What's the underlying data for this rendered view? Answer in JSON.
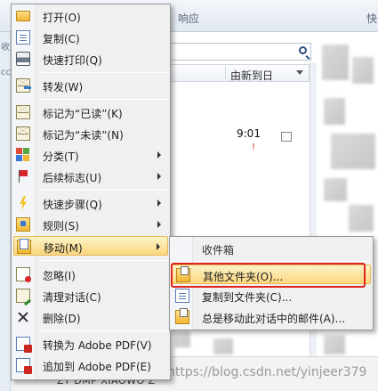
{
  "background": {
    "ribbon_labels": [
      "响应",
      "快"
    ],
    "left_labels": [
      "收",
      "cc"
    ],
    "column_header": "由新到日",
    "message_time": "9:01",
    "bottom_text": "ZT DMP XIAOWO Z",
    "watermark": "https://blog.csdn.net/yinjeer379"
  },
  "menu": {
    "items": [
      {
        "label": "打开(O)",
        "icon": "open-folder-icon"
      },
      {
        "label": "复制(C)",
        "icon": "copy-icon"
      },
      {
        "label": "快速打印(Q)",
        "icon": "printer-icon"
      },
      {
        "label": "转发(W)",
        "icon": "forward-icon"
      },
      {
        "label": "标记为“已读”(K)",
        "icon": "mark-read-icon"
      },
      {
        "label": "标记为“未读”(N)",
        "icon": "mark-unread-icon"
      },
      {
        "label": "分类(T)",
        "icon": "categorize-icon"
      },
      {
        "label": "后续标志(U)",
        "icon": "flag-icon"
      },
      {
        "label": "快速步骤(Q)",
        "icon": "lightning-icon"
      },
      {
        "label": "规则(S)",
        "icon": "rules-icon"
      },
      {
        "label": "移动(M)",
        "icon": "move-icon"
      },
      {
        "label": "忽略(I)",
        "icon": "ignore-icon"
      },
      {
        "label": "清理对话(C)",
        "icon": "clean-up-icon"
      },
      {
        "label": "删除(D)",
        "icon": "delete-icon"
      },
      {
        "label": "转换为 Adobe PDF(V)",
        "icon": "pdf-convert-icon"
      },
      {
        "label": "追加到 Adobe PDF(E)",
        "icon": "pdf-append-icon"
      }
    ]
  },
  "submenu": {
    "header": "收件箱",
    "items": [
      {
        "label": "其他文件夹(O)...",
        "icon": "folder-icon"
      },
      {
        "label": "复制到文件夹(C)...",
        "icon": "copy-to-folder-icon"
      },
      {
        "label": "总是移动此对话中的邮件(A)...",
        "icon": "always-move-icon"
      }
    ]
  },
  "colors": {
    "highlight_top": "#fdf3c8",
    "highlight_bottom": "#fbd77e",
    "annotation": "#e0241b"
  }
}
